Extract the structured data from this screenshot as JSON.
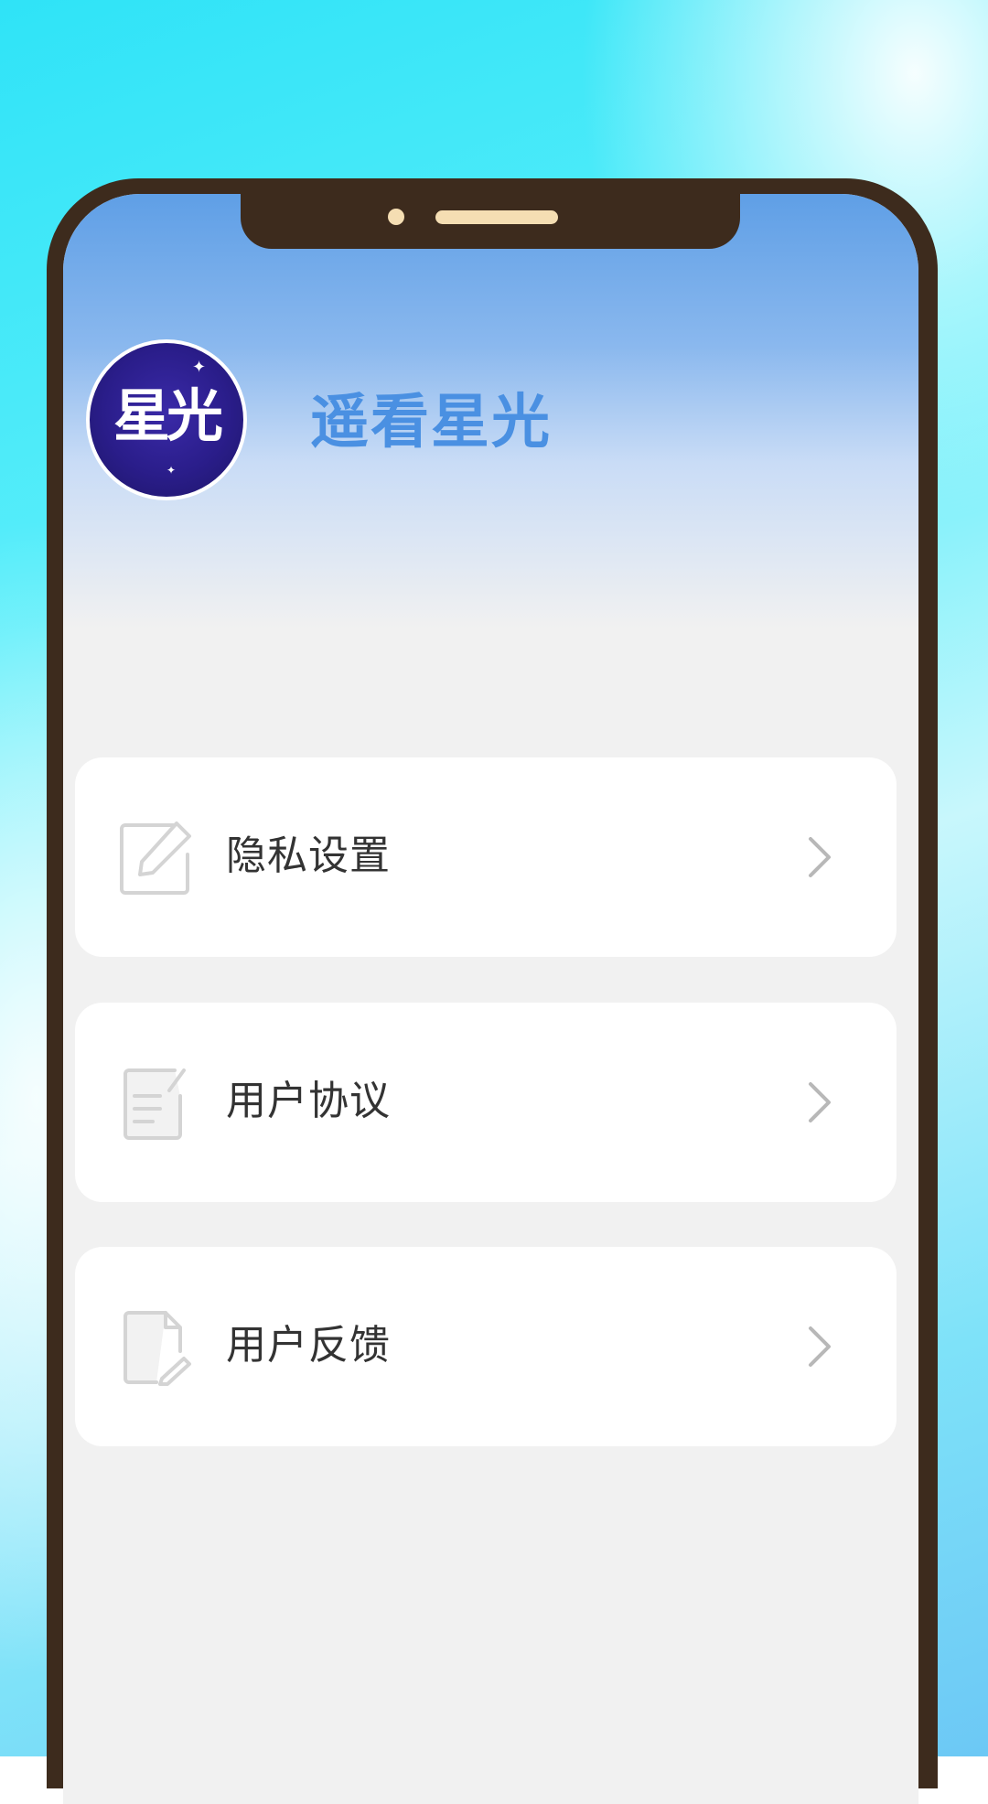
{
  "app": {
    "title": "遥看星光",
    "avatar_text": "星光"
  },
  "menu": {
    "items": [
      {
        "label": "隐私设置",
        "icon": "edit-icon"
      },
      {
        "label": "用户协议",
        "icon": "document-icon"
      },
      {
        "label": "用户反馈",
        "icon": "feedback-icon"
      }
    ],
    "chevron_icon": "chevron-right-icon"
  },
  "colors": {
    "frame": "#3d2b1d",
    "title": "#4a90e2",
    "header_top": "#5f9fe6",
    "card": "#ffffff",
    "page": "#f1f1f1"
  }
}
